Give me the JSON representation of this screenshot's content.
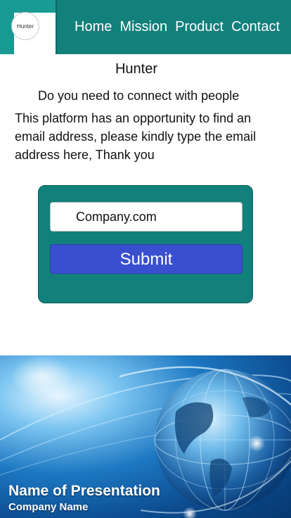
{
  "header": {
    "logo_text": "Hunter",
    "nav": [
      "Home",
      "Mission",
      "Product",
      "Contact"
    ]
  },
  "main": {
    "title": "Hunter",
    "tagline": "Do you need to connect with people",
    "description": "This platform has an opportunity to find an email address, please kindly type the email address here, Thank you"
  },
  "form": {
    "company_value": "Company.com",
    "submit_label": "Submit"
  },
  "banner": {
    "title": "Name of Presentation",
    "subtitle": "Company Name"
  },
  "colors": {
    "header_bg": "#12807b",
    "card_bg": "#12807b",
    "button_bg": "#3a4fd0"
  },
  "icons": [
    "globe-icon"
  ]
}
